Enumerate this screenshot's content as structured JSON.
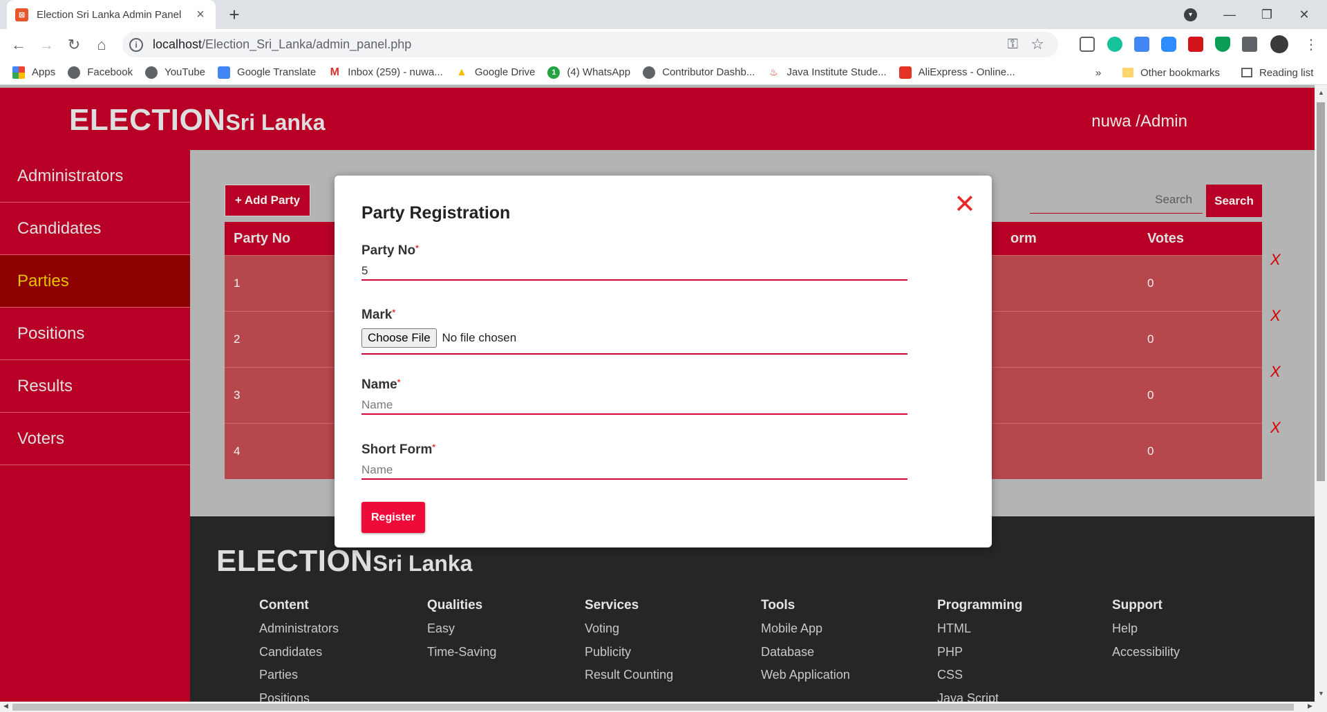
{
  "browser": {
    "tab_title": "Election Sri Lanka Admin Panel",
    "url_host": "localhost",
    "url_path": "/Election_Sri_Lanka/admin_panel.php",
    "bookmarks": [
      {
        "label": "Apps",
        "color": "#4285f4"
      },
      {
        "label": "Facebook",
        "color": "#5f6368"
      },
      {
        "label": "YouTube",
        "color": "#5f6368"
      },
      {
        "label": "Google Translate",
        "color": "#4285f4"
      },
      {
        "label": "Inbox (259) - nuwa...",
        "color": "#d93025"
      },
      {
        "label": "Google Drive",
        "color": "#fbbc04"
      },
      {
        "label": "(4) WhatsApp",
        "color": "#25a244"
      },
      {
        "label": "Contributor Dashb...",
        "color": "#5f6368"
      },
      {
        "label": "Java Institute Stude...",
        "color": "#d93025"
      },
      {
        "label": "AliExpress - Online...",
        "color": "#e43225"
      }
    ],
    "other_bookmarks": "Other bookmarks",
    "reading_list": "Reading list",
    "more_bookmarks": "»"
  },
  "header": {
    "brand_big": "ELECTION",
    "brand_small": "Sri Lanka",
    "user": "nuwa /Admin"
  },
  "sidebar": {
    "items": [
      {
        "label": "Administrators"
      },
      {
        "label": "Candidates"
      },
      {
        "label": "Parties"
      },
      {
        "label": "Positions"
      },
      {
        "label": "Results"
      },
      {
        "label": "Voters"
      }
    ],
    "active": "Parties"
  },
  "toolbar": {
    "add_label": "+ Add Party",
    "search_placeholder": "Search",
    "search_button": "Search"
  },
  "table": {
    "headers": {
      "party_no": "Party No",
      "short_form_partial": "orm",
      "votes": "Votes"
    },
    "rows": [
      {
        "party_no": "1",
        "votes": "0"
      },
      {
        "party_no": "2",
        "votes": "0"
      },
      {
        "party_no": "3",
        "votes": "0"
      },
      {
        "party_no": "4",
        "votes": "0"
      }
    ],
    "delete_glyph": "X"
  },
  "modal": {
    "title": "Party Registration",
    "close_glyph": "✕",
    "fields": {
      "party_no": {
        "label": "Party No",
        "value": "5"
      },
      "mark": {
        "label": "Mark",
        "button": "Choose File",
        "status": "No file chosen"
      },
      "name": {
        "label": "Name",
        "placeholder": "Name"
      },
      "short_form": {
        "label": "Short Form",
        "placeholder": "Name"
      }
    },
    "required_mark": "*",
    "register_label": "Register"
  },
  "footer": {
    "brand_big": "ELECTION",
    "brand_small": "Sri Lanka",
    "columns": [
      {
        "title": "Content",
        "items": [
          "Administrators",
          "Candidates",
          "Parties",
          "Positions"
        ]
      },
      {
        "title": "Qualities",
        "items": [
          "Easy",
          "Time-Saving"
        ]
      },
      {
        "title": "Services",
        "items": [
          "Voting",
          "Publicity",
          "Result Counting"
        ]
      },
      {
        "title": "Tools",
        "items": [
          "Mobile App",
          "Database",
          "Web Application"
        ]
      },
      {
        "title": "Programming",
        "items": [
          "HTML",
          "PHP",
          "CSS",
          "Java Script"
        ]
      },
      {
        "title": "Support",
        "items": [
          "Help",
          "Accessibility"
        ]
      }
    ]
  }
}
